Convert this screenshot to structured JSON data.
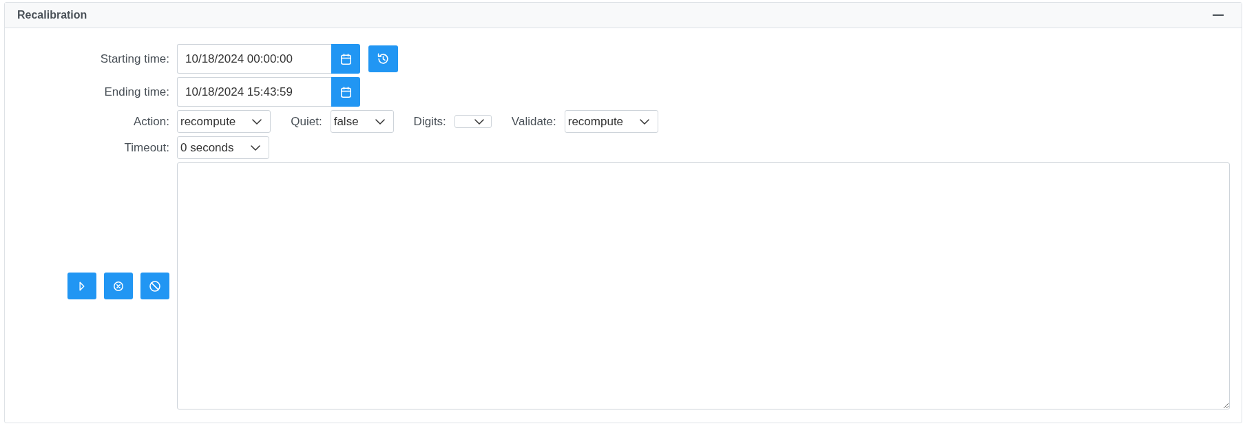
{
  "panel": {
    "title": "Recalibration",
    "collapsed": false
  },
  "time_fields": [
    {
      "label": "Starting time:",
      "value": "10/18/2024 00:00:00",
      "buttons": [
        {
          "kind": "calendar"
        },
        {
          "kind": "history"
        }
      ]
    },
    {
      "label": "Ending time:",
      "value": "10/18/2024 15:43:59",
      "buttons": [
        {
          "kind": "calendar"
        }
      ]
    }
  ],
  "option_rows": [
    {
      "options": [
        {
          "label": "Action:",
          "value": "recompute"
        },
        {
          "label": "Quiet:",
          "value": "false"
        },
        {
          "label": "Digits:"
        },
        {
          "label": "Validate:",
          "value": "recompute"
        }
      ]
    },
    {
      "options": [
        {
          "label": "Timeout:",
          "value": "0 seconds"
        }
      ]
    }
  ],
  "actions": [
    {
      "kind": "play"
    },
    {
      "kind": "cancel"
    },
    {
      "kind": "block"
    }
  ]
}
